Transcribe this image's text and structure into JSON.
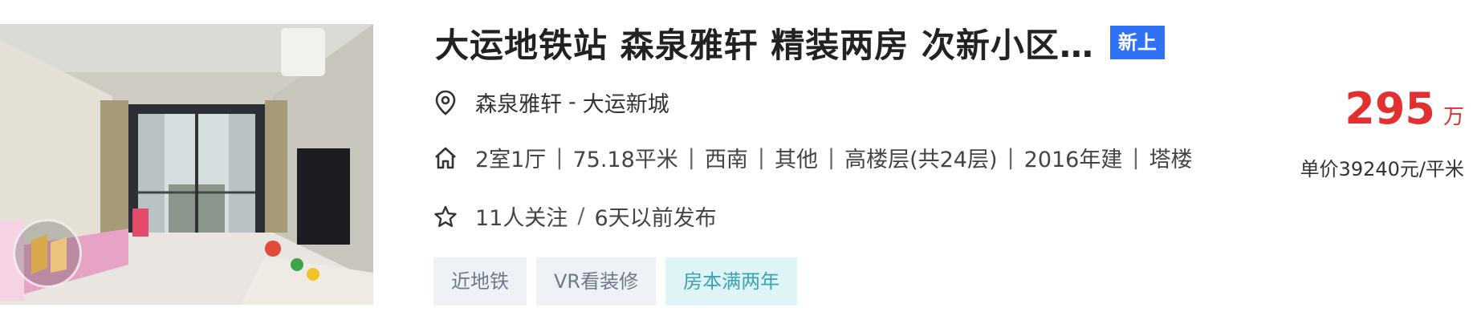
{
  "listing": {
    "title": "大运地铁站 森泉雅轩 精装两房 次新小区…",
    "new_badge": "新上",
    "location": {
      "community": "森泉雅轩",
      "separator": "-",
      "district": "大运新城"
    },
    "info": [
      "2室1厅",
      "75.18平米",
      "西南",
      "其他",
      "高楼层(共24层)",
      "2016年建",
      "塔楼"
    ],
    "info_separator": "|",
    "follow": {
      "followers": "11人关注",
      "separator": "/",
      "published": "6天以前发布"
    },
    "tags": [
      {
        "label": "近地铁"
      },
      {
        "label": "VR看装修"
      },
      {
        "label": "房本满两年"
      }
    ],
    "price": {
      "total": "295",
      "unit": "万",
      "per_unit": "单价39240元/平米"
    },
    "icons": {
      "location": "location-pin-icon",
      "house": "house-icon",
      "follow": "star-icon",
      "vr": "vr-icon"
    },
    "colors": {
      "price": "#e23030",
      "badge": "#3072f6",
      "tag_teal": "#3ba4b2"
    }
  }
}
